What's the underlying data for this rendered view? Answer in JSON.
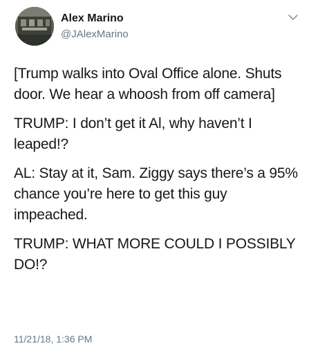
{
  "author": {
    "name": "Alex Marino",
    "handle": "@JAlexMarino"
  },
  "tweet": {
    "paragraphs": [
      "[Trump walks into Oval Office alone. Shuts door. We hear a whoosh from off camera]",
      "TRUMP: I don’t get it Al, why haven’t I leaped!?",
      "AL: Stay at it, Sam. Ziggy says there’s a 95% chance you’re here to get this guy impeached.",
      "TRUMP: WHAT MORE COULD I POSSIBLY DO!?"
    ],
    "timestamp": "11/21/18, 1:36 PM"
  },
  "icons": {
    "menu": "chevron-down-icon"
  },
  "colors": {
    "text": "#14171a",
    "secondary": "#657786"
  }
}
